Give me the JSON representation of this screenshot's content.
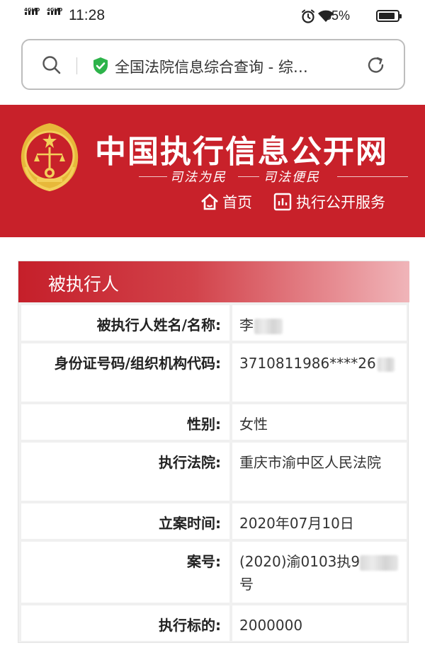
{
  "status_bar": {
    "signal1_label": "4GHD",
    "signal2_label": "4GHD",
    "time": "11:28",
    "battery_percent": "85%",
    "icons": [
      "alarm-icon",
      "wifi-icon",
      "battery-icon"
    ]
  },
  "browser": {
    "url_title": "全国法院信息综合查询 - 综…",
    "icons": [
      "search-icon",
      "secure-shield-icon",
      "reload-icon"
    ],
    "shield_color": "#2db34a"
  },
  "banner": {
    "title": "中国执行信息公开网",
    "slogan_left": "司法为民",
    "slogan_right": "司法便民",
    "nav_home": "首页",
    "nav_service": "执行公开服务",
    "background_color": "#c8212a"
  },
  "card": {
    "heading": "被执行人",
    "rows": [
      {
        "label": "被执行人姓名/名称:",
        "value": "李",
        "redacted": true
      },
      {
        "label": "身份证号码/组织机构代码:",
        "value": "3710811986****26",
        "redacted": true
      },
      {
        "label": "性别:",
        "value": "女性"
      },
      {
        "label": "执行法院:",
        "value": "重庆市渝中区人民法院"
      },
      {
        "label": "立案时间:",
        "value": "2020年07月10日"
      },
      {
        "label": "案号:",
        "value": "(2020)渝0103执9",
        "value_suffix": "号",
        "redacted": true
      },
      {
        "label": "执行标的:",
        "value": "2000000"
      }
    ]
  }
}
